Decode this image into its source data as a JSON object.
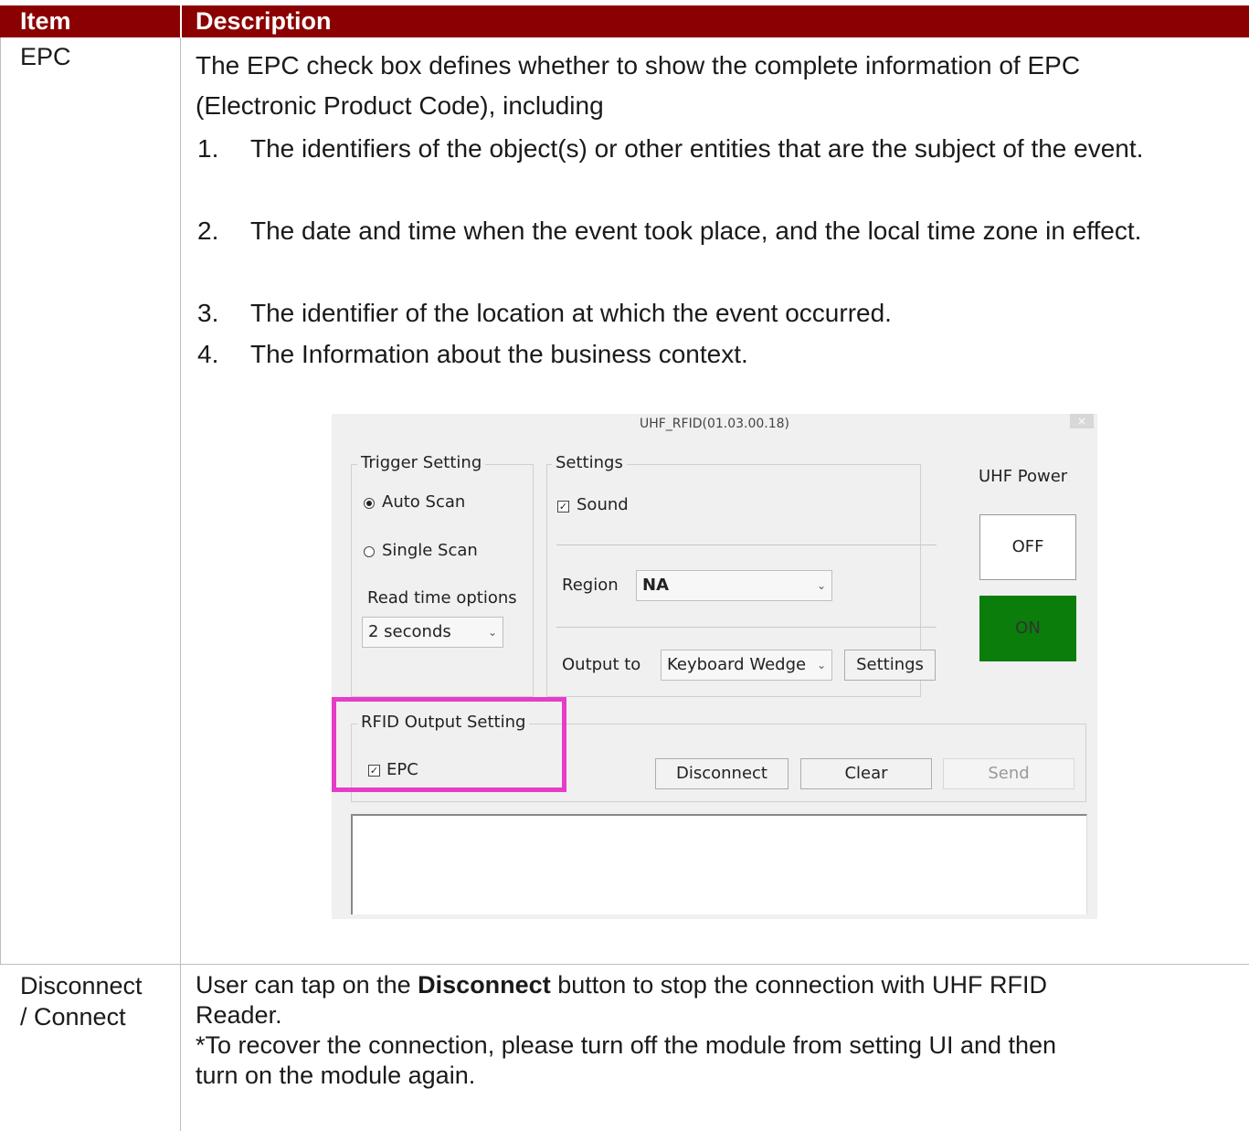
{
  "table": {
    "header_item": "Item",
    "header_description": "Description"
  },
  "row1": {
    "item": "EPC",
    "intro_line1": "The EPC check box defines whether to show the complete information of EPC",
    "intro_line2": "(Electronic Product Code), including",
    "list": [
      {
        "num": "1.",
        "text": "The identifiers of the object(s) or other entities that are the subject of the event."
      },
      {
        "num": "2.",
        "text": "The date and time when the event took place, and the local time zone in effect."
      },
      {
        "num": "3.",
        "text": "The identifier of the location at which the event occurred."
      },
      {
        "num": "4.",
        "text": "The Information about the business context."
      }
    ]
  },
  "dialog": {
    "title": "UHF_RFID(01.03.00.18)",
    "close": "×",
    "trigger_group": "Trigger Setting",
    "auto_scan": "Auto Scan",
    "single_scan": "Single Scan",
    "read_time_label": "Read time options",
    "read_time_value": "2 seconds",
    "settings_group": "Settings",
    "sound": "Sound",
    "region_label": "Region",
    "region_value": "NA",
    "output_label": "Output to",
    "output_value": "Keyboard Wedge",
    "settings_button": "Settings",
    "uhf_power_label": "UHF Power",
    "off_button": "OFF",
    "on_button": "ON",
    "rfid_group": "RFID Output Setting",
    "epc": "EPC",
    "disconnect_button": "Disconnect",
    "clear_button": "Clear",
    "send_button": "Send",
    "check_mark": "✓",
    "arrow": "⌄"
  },
  "row2": {
    "item_line1": "Disconnect",
    "item_line2": "/ Connect",
    "text_pre": "User can tap on the ",
    "text_bold": "Disconnect",
    "text_post": " button to stop the connection with UHF RFID",
    "line2": "Reader.",
    "line3": "*To recover the connection, please turn off the module from setting UI and then",
    "line4": "turn on the module again."
  },
  "colors": {
    "header_bg": "#8b0000",
    "on_button": "#0a7d0a",
    "highlight": "#e63cc8"
  }
}
